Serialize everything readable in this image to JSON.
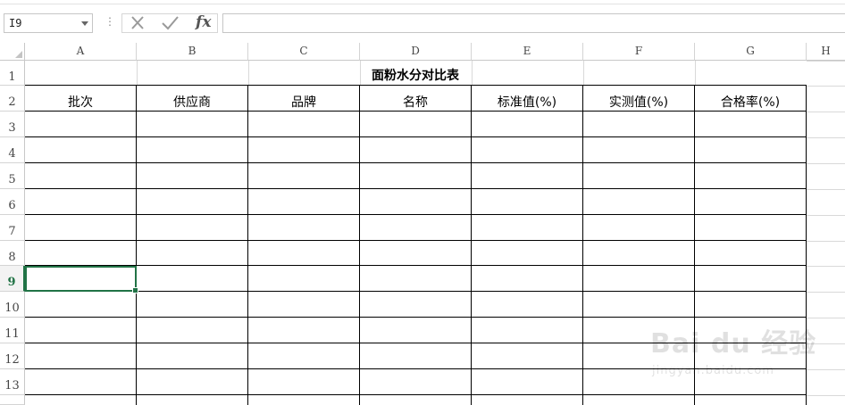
{
  "formula_bar": {
    "name_box": "I9",
    "separator": "⋮",
    "fx_label": "fx",
    "formula_value": ""
  },
  "columns": [
    "A",
    "B",
    "C",
    "D",
    "E",
    "F",
    "G",
    "H"
  ],
  "rows": [
    "1",
    "2",
    "3",
    "4",
    "5",
    "6",
    "7",
    "8",
    "9",
    "10",
    "11",
    "12",
    "13"
  ],
  "selected_row": "9",
  "sheet": {
    "title": "面粉水分对比表",
    "headers": [
      "批次",
      "供应商",
      "品牌",
      "名称",
      "标准值(%)",
      "实测值(%)",
      "合格率(%)"
    ]
  },
  "watermark": {
    "brand": "Bai du 经验",
    "url": "jingyan.baidu.com"
  },
  "colors": {
    "accent": "#217346",
    "border": "#000000",
    "gridline": "#d9d9d9"
  }
}
